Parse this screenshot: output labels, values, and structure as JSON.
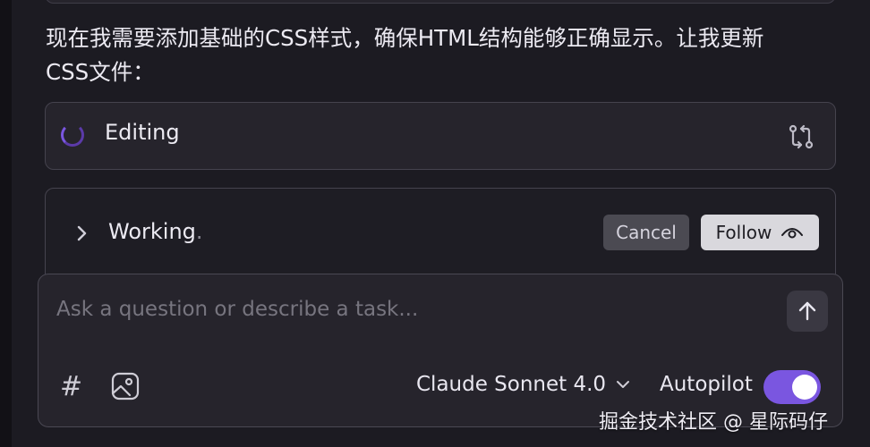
{
  "message": {
    "line1": "现在我需要添加基础的CSS样式，确保HTML结构能够正确显示。让我更新",
    "line2": "CSS文件："
  },
  "editing": {
    "label": "Editing",
    "icon": "swap-icon"
  },
  "working": {
    "label": "Working",
    "dots": ".",
    "cancel_label": "Cancel",
    "follow_label": "Follow",
    "follow_icon": "eye-icon"
  },
  "composer": {
    "placeholder": "Ask a question or describe a task...",
    "model_label": "Claude Sonnet 4.0",
    "autopilot_label": "Autopilot",
    "autopilot_on": true
  },
  "watermark": "掘金技术社区 @ 星际码仔",
  "colors": {
    "accent": "#7a56e0",
    "background": "#1c1b22",
    "card": "#26242c"
  }
}
